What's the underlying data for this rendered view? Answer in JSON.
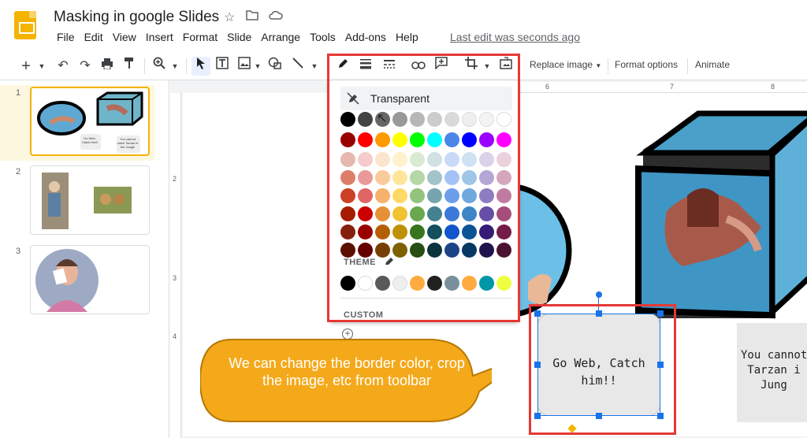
{
  "app": {
    "title": "Masking in google Slides",
    "last_edit": "Last edit was seconds ago",
    "menu": [
      "File",
      "Edit",
      "View",
      "Insert",
      "Format",
      "Slide",
      "Arrange",
      "Tools",
      "Add-ons",
      "Help"
    ]
  },
  "toolbar": {
    "replace_image": "Replace image",
    "format_options": "Format options",
    "animate": "Animate"
  },
  "filmstrip": {
    "slides": [
      {
        "number": "1",
        "note1": "Go Web, Catch him!!",
        "note2": "You cannot catch Tarzan in the Jungle"
      },
      {
        "number": "2"
      },
      {
        "number": "3"
      }
    ]
  },
  "rulers": {
    "top": [
      "6",
      "7",
      "8"
    ],
    "left": [
      "2",
      "3",
      "4"
    ]
  },
  "palette": {
    "transparent_label": "Transparent",
    "theme_label": "THEME",
    "custom_label": "CUSTOM",
    "grays": [
      "#000000",
      "#434343",
      "#666666",
      "#999999",
      "#b7b7b7",
      "#cccccc",
      "#d9d9d9",
      "#efefef",
      "#f3f3f3",
      "#ffffff"
    ],
    "brights": [
      "#980000",
      "#ff0000",
      "#ff9900",
      "#ffff00",
      "#00ff00",
      "#00ffff",
      "#4a86e8",
      "#0000ff",
      "#9900ff",
      "#ff00ff"
    ],
    "shades": [
      [
        "#e6b8af",
        "#f4cccc",
        "#fce5cd",
        "#fff2cc",
        "#d9ead3",
        "#d0e0e3",
        "#c9daf8",
        "#cfe2f3",
        "#d9d2e9",
        "#ead1dc"
      ],
      [
        "#dd7e6b",
        "#ea9999",
        "#f9cb9c",
        "#ffe599",
        "#b6d7a8",
        "#a2c4c9",
        "#a4c2f4",
        "#9fc5e8",
        "#b4a7d6",
        "#d5a6bd"
      ],
      [
        "#cc4125",
        "#e06666",
        "#f6b26b",
        "#ffd966",
        "#93c47d",
        "#76a5af",
        "#6d9eeb",
        "#6fa8dc",
        "#8e7cc3",
        "#c27ba0"
      ],
      [
        "#a61c00",
        "#cc0000",
        "#e69138",
        "#f1c232",
        "#6aa84f",
        "#45818e",
        "#3c78d8",
        "#3d85c6",
        "#674ea7",
        "#a64d79"
      ],
      [
        "#85200c",
        "#990000",
        "#b45f06",
        "#bf9000",
        "#38761d",
        "#134f5c",
        "#1155cc",
        "#0b5394",
        "#351c75",
        "#741b47"
      ],
      [
        "#5b0f00",
        "#660000",
        "#783f04",
        "#7f6000",
        "#274e13",
        "#0c343d",
        "#1c4587",
        "#073763",
        "#20124d",
        "#4c1130"
      ]
    ],
    "theme": [
      "#000000",
      "#ffffff",
      "#595959",
      "#eeeeee",
      "#ffab40",
      "#212121",
      "#78909c",
      "#ffab40",
      "#0097a7",
      "#eeff41"
    ]
  },
  "canvas": {
    "speech_text": "Go Web, Catch him!!",
    "second_box_text": [
      "You cannot",
      "Tarzan i",
      "Jung"
    ]
  },
  "callout": {
    "text": "We can change the border color, crop the image, etc from toolbar"
  }
}
